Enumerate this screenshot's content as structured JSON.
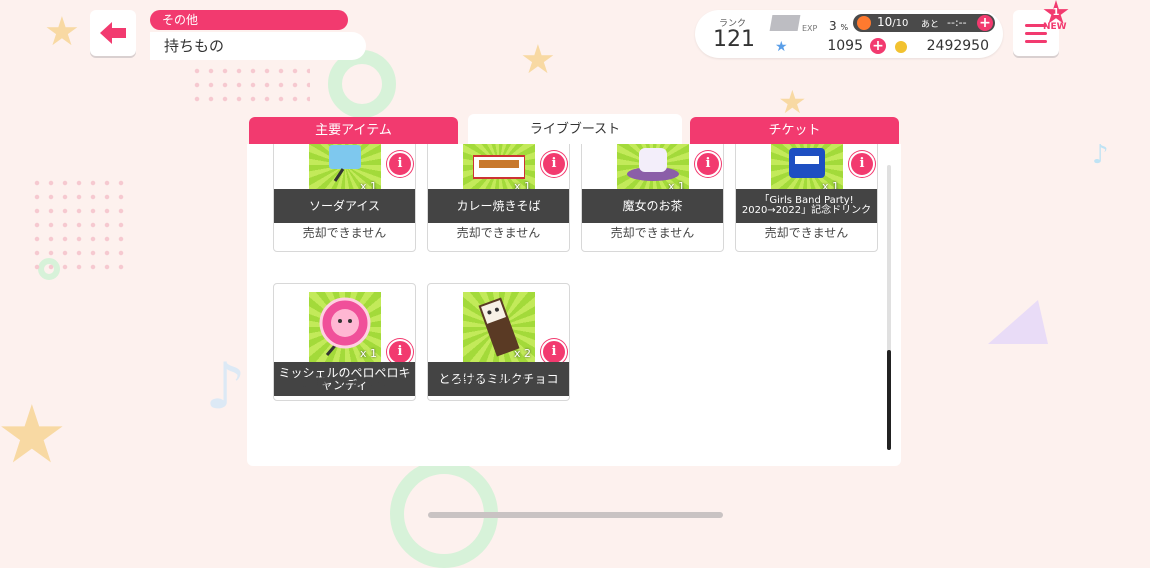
{
  "header": {
    "category": "その他",
    "title": "持ちもの"
  },
  "status": {
    "rank_label": "ランク",
    "rank_value": "121",
    "exp_label": "EXP",
    "exp_percent": "3",
    "exp_unit": "%",
    "stamina_current": "10",
    "stamina_max": "/10",
    "stamina_remaining_label": "あと",
    "stamina_timer": "--:--",
    "star_count": "1095",
    "coin_count": "2492950"
  },
  "menu": {
    "badge_count": "1",
    "new_label": "NEW"
  },
  "tabs": [
    {
      "label": "主要アイテム",
      "active": false
    },
    {
      "label": "ライブブースト",
      "active": true
    },
    {
      "label": "チケット",
      "active": false
    }
  ],
  "items": [
    {
      "name": "ソーダアイス",
      "qty": "x 1",
      "sell": "売却できません",
      "icon": "soda-ice-icon"
    },
    {
      "name": "カレー焼きそば",
      "qty": "x 1",
      "sell": "売却できません",
      "icon": "curry-yakisoba-icon"
    },
    {
      "name": "魔女のお茶",
      "qty": "x 1",
      "sell": "売却できません",
      "icon": "witch-tea-icon"
    },
    {
      "name": "「Girls Band Party! 2020→2022」記念ドリンク",
      "qty": "x 1",
      "sell": "売却できません",
      "icon": "drink-can-icon"
    },
    {
      "name": "ミッシェルのペロペロキャンディ",
      "qty": "x 1",
      "sell": "売却できません",
      "icon": "michelle-lollipop-icon"
    },
    {
      "name": "とろけるミルクチョコ",
      "qty": "x 2",
      "sell": "売却できません",
      "icon": "milk-chocolate-icon"
    }
  ],
  "colors": {
    "accent": "#f23a6f",
    "item_bg": "#a3da3a",
    "name_bar": "#444444"
  }
}
